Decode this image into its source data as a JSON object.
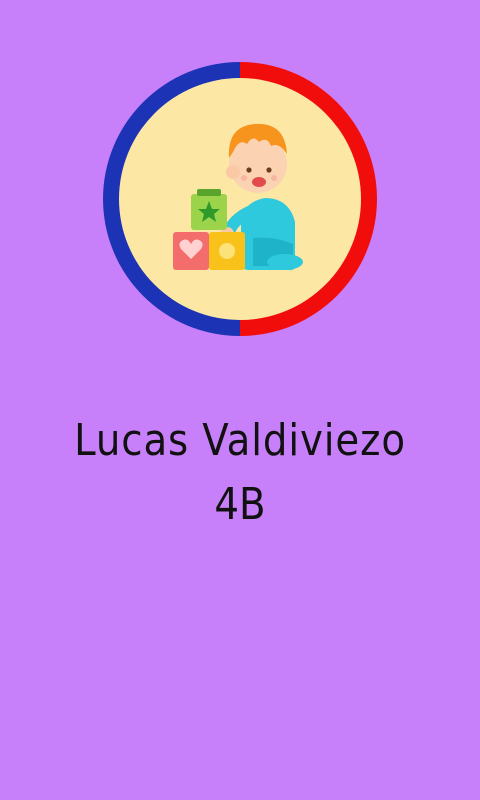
{
  "profile": {
    "name": "Lucas Valdiviezo",
    "grade": "4B",
    "avatar_icon": "baby-with-toy-blocks-icon"
  },
  "colors": {
    "background": "#c880fa",
    "ring_left": "#1d33b5",
    "ring_right": "#f20d0d",
    "avatar_fill": "#fde7a4",
    "text": "#111111"
  }
}
